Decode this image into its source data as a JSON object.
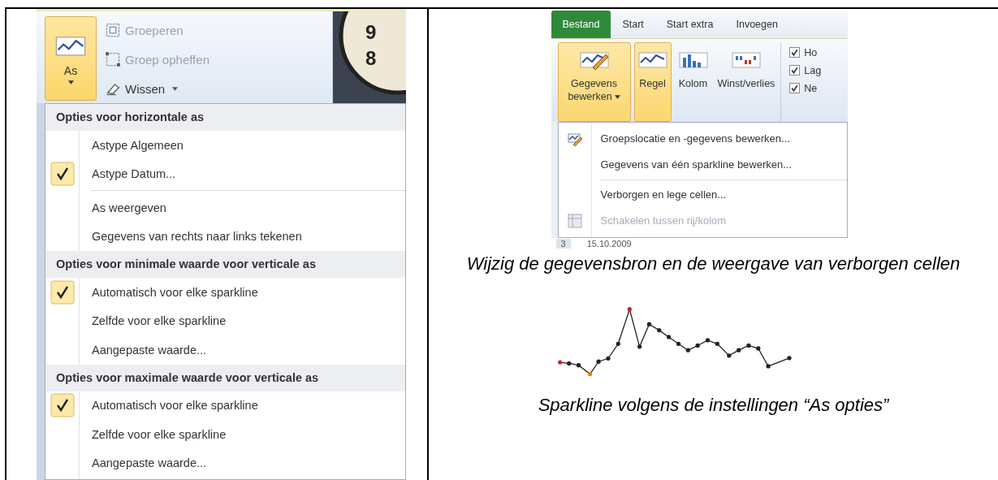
{
  "left_screenshot": {
    "ribbon": {
      "axis_button": {
        "label": "As",
        "selected": true
      },
      "group_buttons": [
        {
          "label": "Groeperen",
          "disabled": true,
          "kind": "group"
        },
        {
          "label": "Groep opheffen",
          "disabled": true,
          "kind": "ungroup"
        },
        {
          "label": "Wissen",
          "disabled": false,
          "kind": "clear"
        }
      ],
      "clock_digits": [
        "9",
        "8"
      ]
    },
    "axis_menu": {
      "sections": [
        {
          "header": "Opties voor horizontale as",
          "items": [
            {
              "kind": "option",
              "label": "Astype Algemeen",
              "checked": false
            },
            {
              "kind": "option",
              "label": "Astype Datum...",
              "checked": true
            },
            {
              "kind": "separator"
            },
            {
              "kind": "option",
              "label": "As weergeven",
              "checked": false
            },
            {
              "kind": "option",
              "label": "Gegevens van rechts naar links tekenen",
              "checked": false
            }
          ]
        },
        {
          "header": "Opties voor minimale waarde voor verticale as",
          "items": [
            {
              "kind": "option",
              "label": "Automatisch voor elke sparkline",
              "checked": true
            },
            {
              "kind": "option",
              "label": "Zelfde voor elke sparkline",
              "checked": false
            },
            {
              "kind": "option",
              "label": "Aangepaste waarde...",
              "checked": false
            }
          ]
        },
        {
          "header": "Opties voor maximale waarde voor verticale as",
          "items": [
            {
              "kind": "option",
              "label": "Automatisch voor elke sparkline",
              "checked": true
            },
            {
              "kind": "option",
              "label": "Zelfde voor elke sparkline",
              "checked": false
            },
            {
              "kind": "option",
              "label": "Aangepaste waarde...",
              "checked": false
            }
          ]
        }
      ]
    }
  },
  "right_screenshot": {
    "tabs": [
      {
        "label": "Bestand",
        "selected": true
      },
      {
        "label": "Start",
        "selected": false
      },
      {
        "label": "Start extra",
        "selected": false
      },
      {
        "label": "Invoegen",
        "selected": false
      }
    ],
    "ribbon_buttons": [
      {
        "label": "Gegevens bewerken",
        "kind": "edit",
        "selected": true,
        "dropdown": true
      },
      {
        "label": "Regel",
        "kind": "line",
        "selected": true,
        "dropdown": false
      },
      {
        "label": "Kolom",
        "kind": "column",
        "selected": false,
        "dropdown": false
      },
      {
        "label": "Winst/verlies",
        "kind": "winloss",
        "selected": false,
        "dropdown": false
      }
    ],
    "checkboxes": [
      {
        "label": "Ho",
        "checked": true
      },
      {
        "label": "Lag",
        "checked": true
      },
      {
        "label": "Ne",
        "checked": true
      }
    ],
    "menu_items": [
      {
        "kind": "edit",
        "label": "Groepslocatie en -gegevens bewerken...",
        "disabled": false
      },
      {
        "kind": "plain",
        "label": "Gegevens van één sparkline bewerken...",
        "disabled": false
      },
      {
        "kind": "separator"
      },
      {
        "kind": "plain",
        "label": "Verborgen en lege cellen...",
        "disabled": false
      },
      {
        "kind": "switch",
        "label": "Schakelen tussen rij/kolom",
        "disabled": true
      }
    ],
    "sheet_row": {
      "row_number": "3",
      "cell": "15.10.2009"
    }
  },
  "captions": [
    "Wijzig de gegevensbron en de weergave van verborgen cellen",
    "Sparkline volgens de instellingen “As opties”"
  ]
}
